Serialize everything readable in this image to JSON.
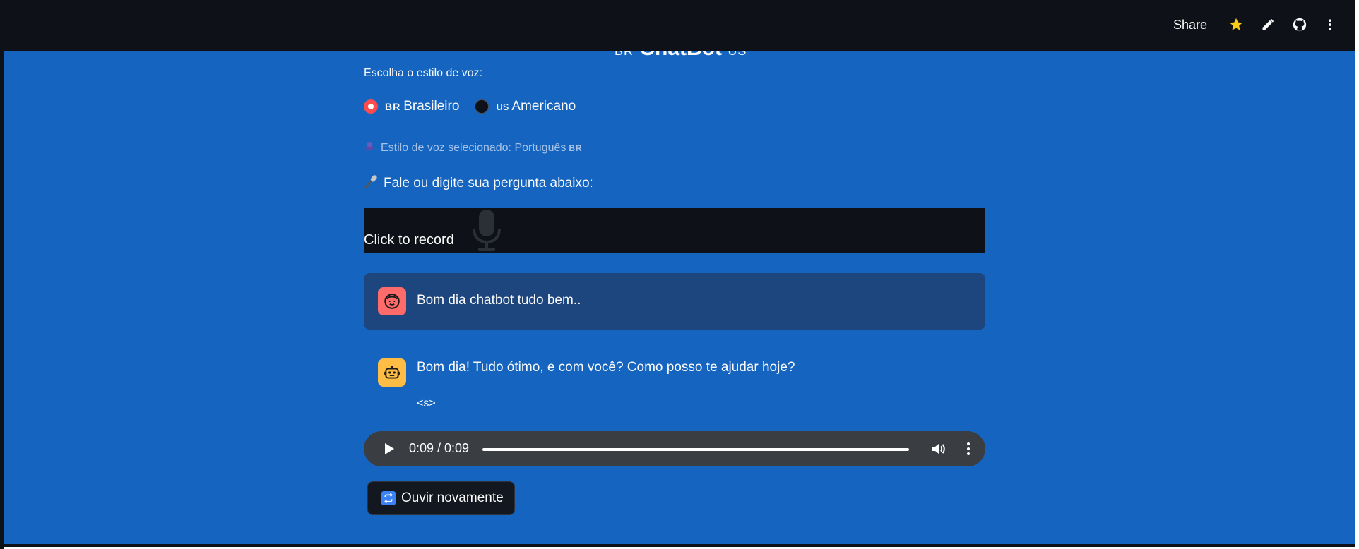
{
  "header": {
    "share_label": "Share",
    "icons": [
      "star-icon",
      "pencil-icon",
      "github-icon",
      "more-vertical-icon"
    ]
  },
  "title": {
    "flag": "BR",
    "text": "ChatBot",
    "suffix": "US"
  },
  "voice": {
    "label": "Escolha o estilo de voz:",
    "options": [
      {
        "flag": "BR",
        "label": "Brasileiro",
        "selected": true
      },
      {
        "flag": "us",
        "label": "Americano",
        "selected": false
      }
    ],
    "selected_text": "Estilo de voz selecionado: Português",
    "selected_flag": "BR"
  },
  "prompt": {
    "text": "Fale ou digite sua pergunta abaixo:"
  },
  "recorder": {
    "label": "Click to record"
  },
  "chat": {
    "user_message": "Bom dia chatbot tudo bem..",
    "bot_message": "Bom dia! Tudo ótimo, e com você? Como posso te ajudar hoje?",
    "bot_extra": "<s>"
  },
  "audio": {
    "time": "0:09 / 0:09",
    "progress": 1.0
  },
  "replay": {
    "label": "Ouvir novamente"
  },
  "colors": {
    "app_bg": "#1565c0",
    "header_bg": "#0e1117",
    "radio_accent": "#ff4b4b",
    "user_avatar": "#ff6b6b",
    "bot_avatar": "#ffbd45",
    "star": "#facc15"
  }
}
